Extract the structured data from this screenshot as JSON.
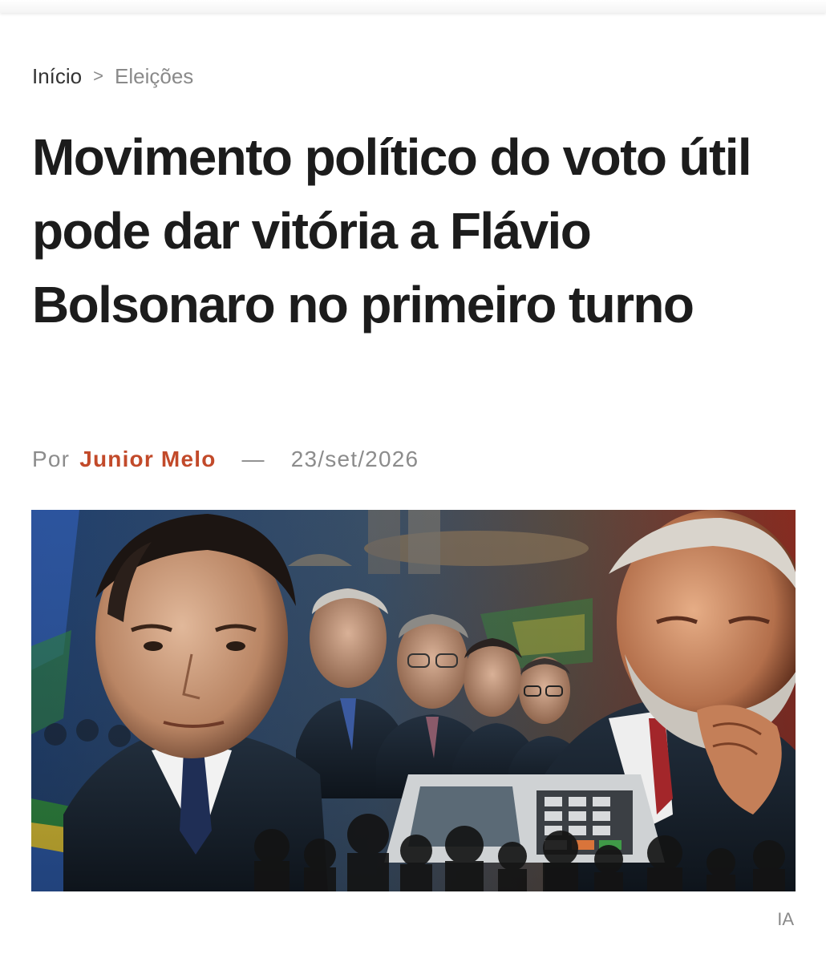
{
  "breadcrumb": {
    "home": "Início",
    "separator": ">",
    "current": "Eleições"
  },
  "article": {
    "headline": "Movimento político do voto útil pode dar vitória a Flávio Bolsonaro no primeiro turno",
    "byline_prefix": "Por",
    "author": "Junior Melo",
    "byline_separator": "—",
    "date": "23/set/2026"
  },
  "image": {
    "credit": "IA"
  },
  "colors": {
    "author_accent": "#c24a2a",
    "muted_text": "#8a8a8a",
    "headline_text": "#1c1c1c"
  }
}
